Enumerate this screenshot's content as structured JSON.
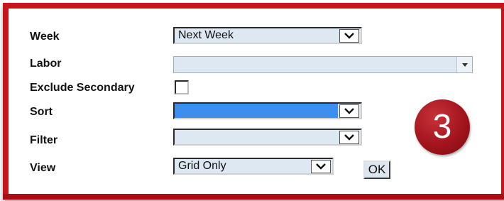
{
  "form": {
    "week": {
      "label": "Week",
      "value": "Next Week"
    },
    "labor": {
      "label": "Labor",
      "value": ""
    },
    "exclude_secondary": {
      "label": "Exclude Secondary",
      "checked": false
    },
    "sort": {
      "label": "Sort",
      "value": ""
    },
    "filter": {
      "label": "Filter",
      "value": ""
    },
    "view": {
      "label": "View",
      "value": "Grid Only"
    },
    "ok_label": "OK"
  },
  "badge": {
    "number": "3"
  },
  "colors": {
    "frame_border": "#c8151c",
    "select_background": "#dde8f2",
    "sort_highlight": "#3d8fef",
    "badge_background": "#a3141c"
  }
}
